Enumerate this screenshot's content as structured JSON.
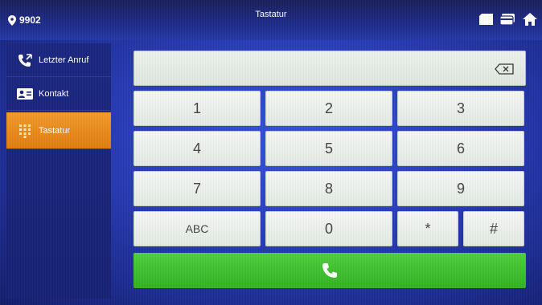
{
  "header": {
    "room_number": "9902",
    "title": "Tastatur",
    "icons": [
      "location-pin-icon",
      "message-icon",
      "card-icon",
      "home-icon"
    ]
  },
  "sidebar": {
    "items": [
      {
        "label": "Letzter Anruf",
        "icon": "call-log-icon",
        "active": false
      },
      {
        "label": "Kontakt",
        "icon": "contact-card-icon",
        "active": false
      },
      {
        "label": "Tastatur",
        "icon": "keypad-icon",
        "active": true
      }
    ]
  },
  "dialpad": {
    "display_value": "",
    "keys": [
      [
        "1",
        "2",
        "3"
      ],
      [
        "4",
        "5",
        "6"
      ],
      [
        "7",
        "8",
        "9"
      ],
      [
        "ABC",
        "0",
        "*",
        "#"
      ]
    ],
    "call_icon": "phone-icon"
  },
  "colors": {
    "active_item": "#f08a1c",
    "call_button": "#3cbf2c",
    "background": "#2a3fc0"
  }
}
